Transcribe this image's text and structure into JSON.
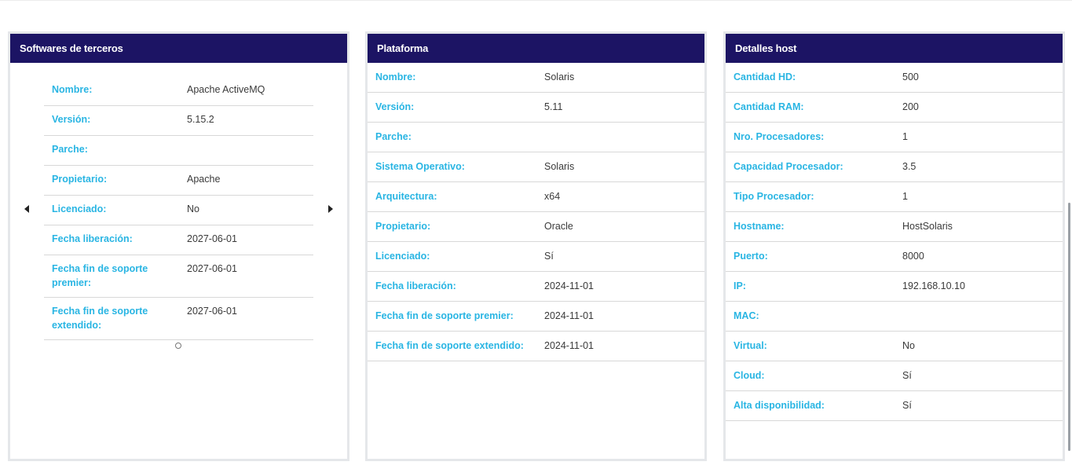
{
  "software": {
    "title": "Softwares de terceros",
    "rows": [
      {
        "label": "Nombre:",
        "value": "Apache ActiveMQ"
      },
      {
        "label": "Versión:",
        "value": "5.15.2"
      },
      {
        "label": "Parche:",
        "value": ""
      },
      {
        "label": "Propietario:",
        "value": "Apache"
      },
      {
        "label": "Licenciado:",
        "value": "No"
      },
      {
        "label": "Fecha liberación:",
        "value": "2027-06-01"
      },
      {
        "label": "Fecha fin de soporte premier:",
        "value": "2027-06-01"
      },
      {
        "label": "Fecha fin de soporte extendido:",
        "value": "2027-06-01"
      }
    ]
  },
  "platform": {
    "title": "Plataforma",
    "rows": [
      {
        "label": "Nombre:",
        "value": "Solaris"
      },
      {
        "label": "Versión:",
        "value": "5.11"
      },
      {
        "label": "Parche:",
        "value": ""
      },
      {
        "label": "Sistema Operativo:",
        "value": "Solaris"
      },
      {
        "label": "Arquitectura:",
        "value": "x64"
      },
      {
        "label": "Propietario:",
        "value": "Oracle"
      },
      {
        "label": "Licenciado:",
        "value": "Sí"
      },
      {
        "label": "Fecha liberación:",
        "value": "2024-11-01"
      },
      {
        "label": "Fecha fin de soporte premier:",
        "value": "2024-11-01"
      },
      {
        "label": "Fecha fin de soporte extendido:",
        "value": "2024-11-01"
      }
    ]
  },
  "host": {
    "title": "Detalles host",
    "rows": [
      {
        "label": "Cantidad HD:",
        "value": "500"
      },
      {
        "label": "Cantidad RAM:",
        "value": "200"
      },
      {
        "label": "Nro. Procesadores:",
        "value": "1"
      },
      {
        "label": "Capacidad Procesador:",
        "value": "3.5"
      },
      {
        "label": "Tipo Procesador:",
        "value": "1"
      },
      {
        "label": "Hostname:",
        "value": "HostSolaris"
      },
      {
        "label": "Puerto:",
        "value": "8000"
      },
      {
        "label": "IP:",
        "value": "192.168.10.10"
      },
      {
        "label": "MAC:",
        "value": ""
      },
      {
        "label": "Virtual:",
        "value": "No"
      },
      {
        "label": "Cloud:",
        "value": "Sí"
      },
      {
        "label": "Alta disponibilidad:",
        "value": "Sí"
      }
    ]
  },
  "icons": {
    "prev": "caret-left-icon",
    "next": "caret-right-icon",
    "pager": "carousel-dot-icon"
  },
  "colors": {
    "header": "#1c1464",
    "label": "#29b5e3"
  }
}
